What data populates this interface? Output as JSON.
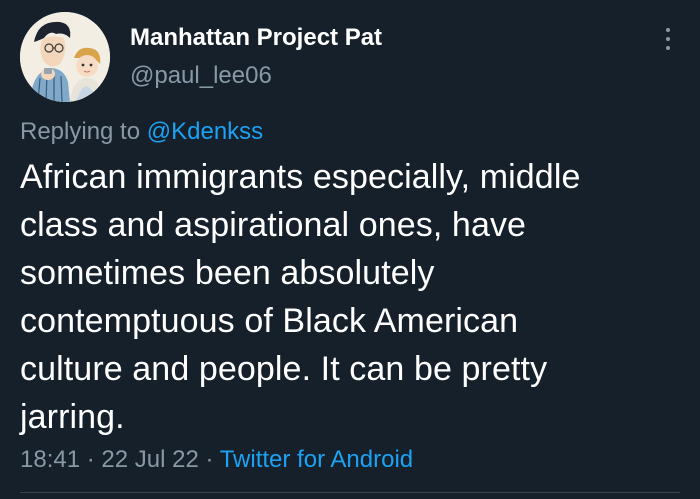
{
  "user": {
    "display_name": "Manhattan Project Pat",
    "handle": "@paul_lee06",
    "avatar_icon": "avatar-illustration"
  },
  "reply": {
    "prefix": "Replying to ",
    "mention": "@Kdenkss"
  },
  "tweet": {
    "lines": [
      "African immigrants especially, middle",
      "class and aspirational ones, have",
      "sometimes been absolutely",
      "contemptuous of Black American",
      "culture and people. It can be pretty",
      "jarring."
    ]
  },
  "meta": {
    "time": "18:41",
    "separator": " · ",
    "date": "22 Jul 22",
    "source": "Twitter for Android"
  },
  "icons": {
    "more": "more-vertical-icon"
  },
  "colors": {
    "background": "#15202b",
    "text": "#ffffff",
    "secondary": "#8899a6",
    "accent": "#1da1f2"
  }
}
